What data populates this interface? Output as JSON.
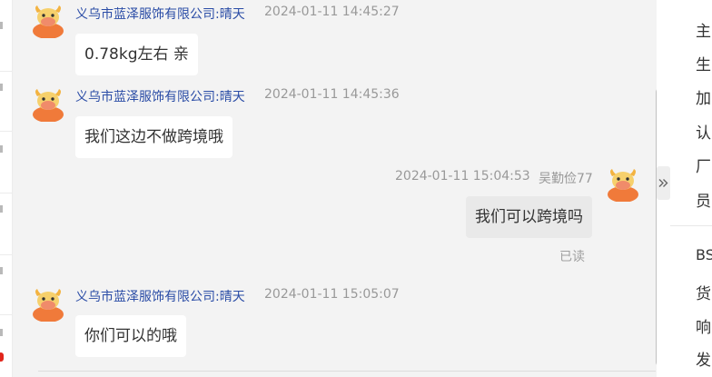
{
  "messages": [
    {
      "sender": "义乌市蓝泽服饰有限公司:晴天",
      "time": "2024-01-11 14:45:27",
      "text": "0.78kg左右 亲"
    },
    {
      "sender": "义乌市蓝泽服饰有限公司:晴天",
      "time": "2024-01-11 14:45:36",
      "text": "我们这边不做跨境哦"
    },
    {
      "sender": "吴勤俭77",
      "time": "2024-01-11 15:04:53",
      "text": "我们可以跨境吗",
      "status": "已读"
    },
    {
      "sender": "义乌市蓝泽服饰有限公司:晴天",
      "time": "2024-01-11 15:05:07",
      "text": "你们可以的哦"
    }
  ],
  "side_panel": {
    "labels": [
      "主",
      "生",
      "加",
      "认",
      "厂",
      "员",
      "BS",
      "货",
      "响",
      "发"
    ]
  },
  "icons": {
    "avatar": "bull-mascot-icon",
    "collapse": "double-chevron-right-icon"
  },
  "colors": {
    "sender_name": "#2a4ca6",
    "avatar_body": "#f07a3a",
    "chat_bg": "#f3f3f3",
    "unread_dot": "#e1251b"
  }
}
